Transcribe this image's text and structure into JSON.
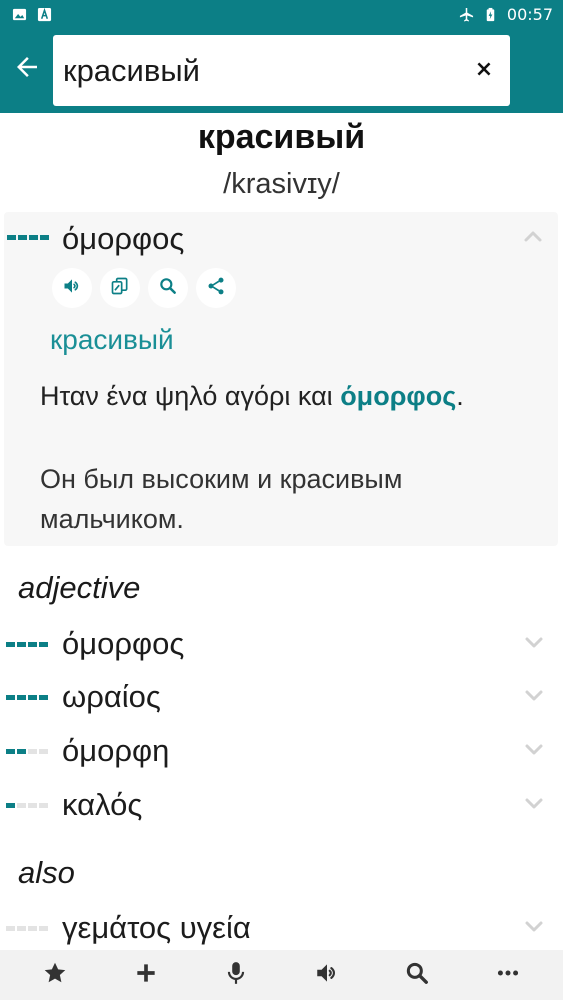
{
  "status_bar": {
    "time": "00:57",
    "left_icons": [
      "image-icon",
      "a-box-icon"
    ],
    "right_icons": [
      "airplane-icon",
      "battery-charging-icon"
    ]
  },
  "search": {
    "value": "красивый",
    "back_icon": "arrow-left-icon",
    "clear_label": "×"
  },
  "entry": {
    "headword": "красивый",
    "transcription": "/krasivɪy/"
  },
  "expanded": {
    "word": "όμορφος",
    "frequency": 4,
    "actions": [
      "speaker-icon",
      "copy-icon",
      "search-icon",
      "share-icon"
    ],
    "back_translation": "красивый",
    "example_before": "Ηταν ένα ψηλό αγόρι και ",
    "example_highlight": "όμορφος",
    "example_after": ".",
    "example_translation": "Он был высоким и красивым мальчиком."
  },
  "sections": [
    {
      "label": "adjective",
      "items": [
        {
          "word": "όμορφος",
          "frequency": 4
        },
        {
          "word": "ωραίος",
          "frequency": 4
        },
        {
          "word": "όμορφη",
          "frequency": 2
        },
        {
          "word": "καλός",
          "frequency": 1
        }
      ]
    },
    {
      "label": "also",
      "items": [
        {
          "word": "γεμάτος υγεία",
          "frequency": 0
        }
      ]
    }
  ],
  "bottom_nav": [
    "star-icon",
    "plus-icon",
    "microphone-icon",
    "speaker-icon",
    "search-icon",
    "more-icon"
  ],
  "colors": {
    "accent": "#0c7f86",
    "highlight": "#1a8f96"
  }
}
